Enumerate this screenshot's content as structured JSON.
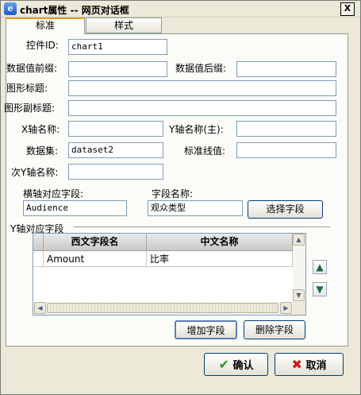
{
  "window": {
    "title": "chart属性 -- 网页对话框",
    "app_icon": "ie-icon",
    "close_icon": "close-icon",
    "close_glyph": "X"
  },
  "tabs": [
    {
      "label": "标准",
      "active": true
    },
    {
      "label": "样式",
      "active": false
    }
  ],
  "form": {
    "control_id": {
      "label": "控件ID:",
      "value": "chart1"
    },
    "value_prefix": {
      "label": "数据值前缀:",
      "value": ""
    },
    "value_suffix": {
      "label": "数据值后缀:",
      "value": ""
    },
    "graph_title": {
      "label": "图形标题:",
      "value": ""
    },
    "graph_subtitle": {
      "label": "图形副标题:",
      "value": ""
    },
    "x_axis_name": {
      "label": "X轴名称:",
      "value": ""
    },
    "y_axis_name": {
      "label": "Y轴名称(主):",
      "value": ""
    },
    "dataset": {
      "label": "数据集:",
      "value": "dataset2"
    },
    "standard_line": {
      "label": "标准线值:",
      "value": ""
    },
    "secondary_y_axis": {
      "label": "次Y轴名称:",
      "value": ""
    },
    "x_axis_field": {
      "label": "横轴对应字段:",
      "value": "Audience"
    },
    "field_name": {
      "label": "字段名称:",
      "value": "观众类型"
    }
  },
  "buttons": {
    "select_field": "选择字段",
    "add_field": "增加字段",
    "delete_field": "删除字段",
    "ok": "确认",
    "cancel": "取消"
  },
  "y_fields": {
    "group_label": "Y轴对应字段",
    "columns": [
      "西文字段名",
      "中文名称"
    ],
    "rows": [
      {
        "field": "Amount",
        "name": "比率"
      }
    ]
  },
  "icons": {
    "move_up": "arrow-up-icon",
    "move_down": "arrow-down-icon",
    "ok": "checkmark-icon",
    "cancel": "x-icon"
  }
}
